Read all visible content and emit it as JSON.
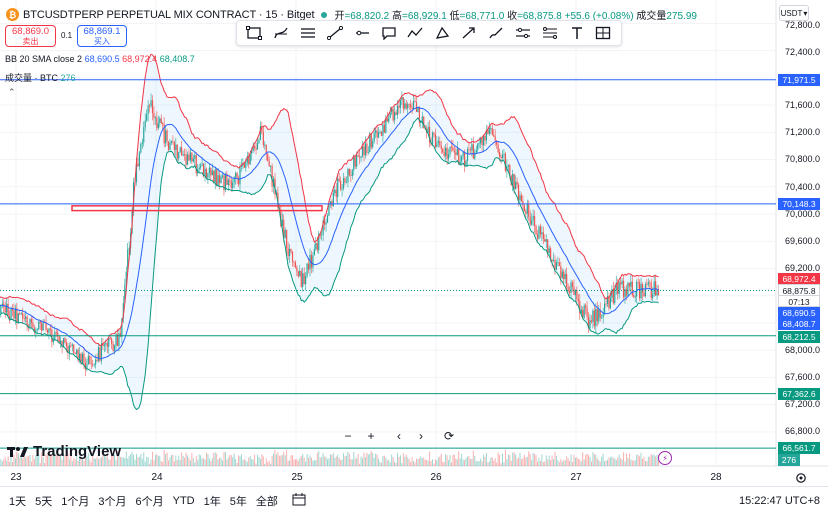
{
  "header": {
    "coin_icon": "bitcoin-icon",
    "symbol": "BTCUSDTPERP PERPETUAL MIX CONTRACT · 15 · Bitget",
    "open_label": "开",
    "open": "=68,820.2",
    "high_label": "高",
    "high": "=68,929.1",
    "low_label": "低",
    "low": "=68,771.0",
    "close_label": "收",
    "close": "=68,875.8",
    "change": "+55.6 (+0.08%)",
    "volume_label": "成交量",
    "volume": "275.99"
  },
  "trade": {
    "sell_price": "68,869.0",
    "sell_label": "卖出",
    "spread": "0.1",
    "buy_price": "68,869.1",
    "buy_label": "买入"
  },
  "legend": {
    "bb_name": "BB 20 SMA close 2",
    "bb_basis": "68,690.5",
    "bb_upper": "68,972.4",
    "bb_lower": "68,408.7",
    "vol_name": "成交量 · BTC",
    "vol_value": "276"
  },
  "toolbar": {
    "tools": [
      "rectangle-icon",
      "path-icon",
      "parallel-channel-icon",
      "trend-line-icon",
      "horizontal-ray-icon",
      "callout-icon",
      "polyline-icon",
      "triangle-icon",
      "arrow-icon",
      "brush-icon",
      "cross-line-icon",
      "fib-icon",
      "text-icon",
      "table-icon"
    ]
  },
  "currency": "USDT",
  "price_axis": [
    "72,800.0",
    "72,400.0",
    "71,600.0",
    "71,200.0",
    "70,800.0",
    "70,400.0",
    "70,000.0",
    "69,600.0",
    "69,200.0",
    "68,000.0",
    "67,600.0",
    "67,200.0",
    "66,800.0"
  ],
  "price_tags": {
    "line_71971": "71,971.5",
    "line_70148": "70,148.3",
    "bb_upper": "68,972.4",
    "last": "68,875.8",
    "countdown": "07:13",
    "bb_basis": "68,690.5",
    "bb_lower": "68,408.7",
    "line_68212": "68,212.5",
    "line_67362": "67,362.6",
    "line_66561": "66,561.7",
    "volume": "276"
  },
  "time_axis": [
    "23",
    "24",
    "25",
    "26",
    "27",
    "28"
  ],
  "logo_text": "TradingView",
  "zoom_controls": {
    "minus": "−",
    "plus": "+",
    "left": "‹",
    "right": "›",
    "reset": "⟳"
  },
  "ranges": [
    "1天",
    "5天",
    "1个月",
    "3个月",
    "6个月",
    "YTD",
    "1年",
    "5年",
    "全部"
  ],
  "clock": "15:22:47 UTC+8",
  "chart_data": {
    "type": "candlestick",
    "instrument": "BTCUSDTPERP",
    "interval": "15",
    "ylim": [
      66400,
      73000
    ],
    "x_labels": [
      "23",
      "24",
      "25",
      "26",
      "27",
      "28"
    ],
    "close_path": [
      {
        "day": 22.85,
        "close": 68650
      },
      {
        "day": 23.0,
        "close": 68500
      },
      {
        "day": 23.3,
        "close": 68200
      },
      {
        "day": 23.5,
        "close": 67800
      },
      {
        "day": 23.75,
        "close": 68200
      },
      {
        "day": 23.85,
        "close": 70600
      },
      {
        "day": 23.95,
        "close": 71600
      },
      {
        "day": 24.1,
        "close": 71000
      },
      {
        "day": 24.3,
        "close": 70700
      },
      {
        "day": 24.55,
        "close": 70400
      },
      {
        "day": 24.75,
        "close": 71200
      },
      {
        "day": 24.95,
        "close": 69400
      },
      {
        "day": 25.05,
        "close": 69000
      },
      {
        "day": 25.3,
        "close": 70400
      },
      {
        "day": 25.5,
        "close": 71000
      },
      {
        "day": 25.8,
        "close": 71700
      },
      {
        "day": 26.0,
        "close": 71000
      },
      {
        "day": 26.2,
        "close": 70800
      },
      {
        "day": 26.4,
        "close": 71200
      },
      {
        "day": 26.6,
        "close": 70200
      },
      {
        "day": 26.85,
        "close": 69300
      },
      {
        "day": 27.1,
        "close": 68400
      },
      {
        "day": 27.3,
        "close": 68900
      },
      {
        "day": 27.6,
        "close": 68880
      }
    ],
    "horizontal_lines": [
      71971.5,
      70148.3,
      68212.5,
      67362.6,
      66561.7
    ],
    "red_zone": [
      70050,
      70120
    ],
    "indicator": {
      "name": "BB 20 SMA close 2",
      "basis": 68690.5,
      "upper": 68972.4,
      "lower": 68408.7
    },
    "last_price": 68875.8,
    "volume_last": 276
  }
}
